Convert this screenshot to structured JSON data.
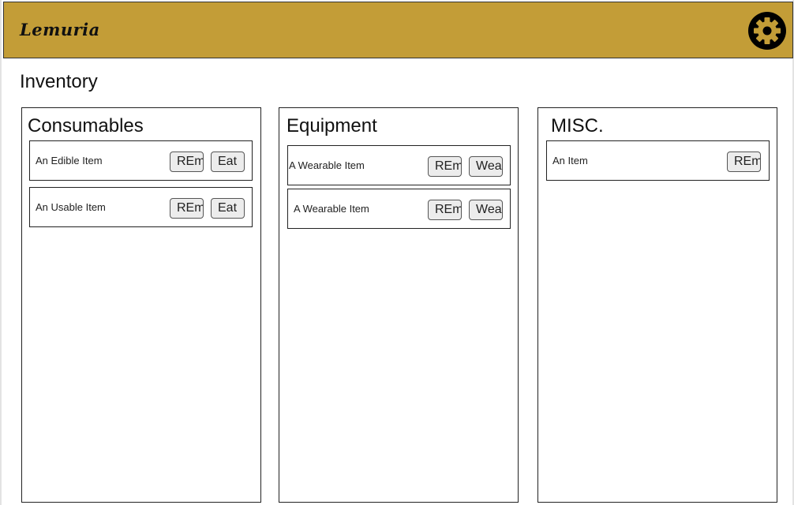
{
  "app": {
    "logo_text": "Lemuria",
    "settings_icon": "gear-icon"
  },
  "page": {
    "title": "Inventory"
  },
  "panels": {
    "consumables": {
      "title": "Consumables",
      "items": [
        {
          "label": "An Edible Item",
          "remove_label": "REmove",
          "action_label": "Eat"
        },
        {
          "label": "An Usable Item",
          "remove_label": "REmove",
          "action_label": "Eat"
        }
      ]
    },
    "equipment": {
      "title": "Equipment",
      "items": [
        {
          "label": "A Wearable Item",
          "remove_label": "REmove",
          "action_label": "Wear"
        },
        {
          "label": "A Wearable Item",
          "remove_label": "REmove",
          "action_label": "Wear"
        }
      ]
    },
    "misc": {
      "title": "MISC.",
      "items": [
        {
          "label": "An Item",
          "remove_label": "REmove"
        }
      ]
    }
  },
  "colors": {
    "header_bg": "#c39d37",
    "button_bg": "#ececec"
  }
}
